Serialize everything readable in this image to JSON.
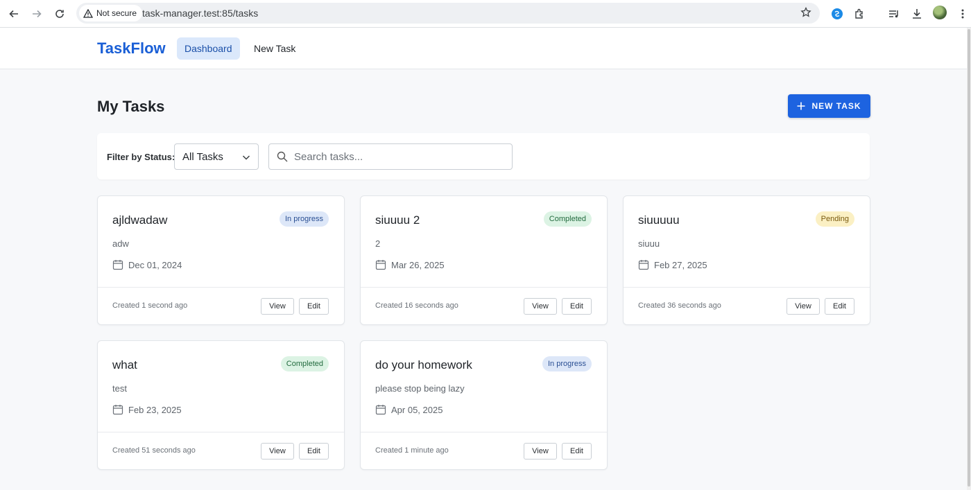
{
  "browser": {
    "security_label": "Not secure",
    "url": "task-manager.test:85/tasks"
  },
  "app": {
    "brand": "TaskFlow",
    "nav": [
      {
        "label": "Dashboard",
        "active": true
      },
      {
        "label": "New Task",
        "active": false
      }
    ]
  },
  "page": {
    "title": "My Tasks",
    "new_task_button": "NEW TASK"
  },
  "filters": {
    "status_label": "Filter by Status:",
    "status_value": "All Tasks",
    "search_placeholder": "Search tasks..."
  },
  "tasks": [
    {
      "title": "ajldwadaw",
      "status": "In progress",
      "status_kind": "progress",
      "description": "adw",
      "due": "Dec 01, 2024",
      "created": "Created 1 second ago",
      "view": "View",
      "edit": "Edit"
    },
    {
      "title": "siuuuu 2",
      "status": "Completed",
      "status_kind": "completed",
      "description": "2",
      "due": "Mar 26, 2025",
      "created": "Created 16 seconds ago",
      "view": "View",
      "edit": "Edit"
    },
    {
      "title": "siuuuuu",
      "status": "Pending",
      "status_kind": "pending",
      "description": "siuuu",
      "due": "Feb 27, 2025",
      "created": "Created 36 seconds ago",
      "view": "View",
      "edit": "Edit"
    },
    {
      "title": "what",
      "status": "Completed",
      "status_kind": "completed",
      "description": "test",
      "due": "Feb 23, 2025",
      "created": "Created 51 seconds ago",
      "view": "View",
      "edit": "Edit"
    },
    {
      "title": "do your homework",
      "status": "In progress",
      "status_kind": "progress",
      "description": "please stop being lazy",
      "due": "Apr 05, 2025",
      "created": "Created 1 minute ago",
      "view": "View",
      "edit": "Edit"
    }
  ],
  "colors": {
    "brand": "#1a5fd6",
    "primary_button": "#1d63e0"
  }
}
